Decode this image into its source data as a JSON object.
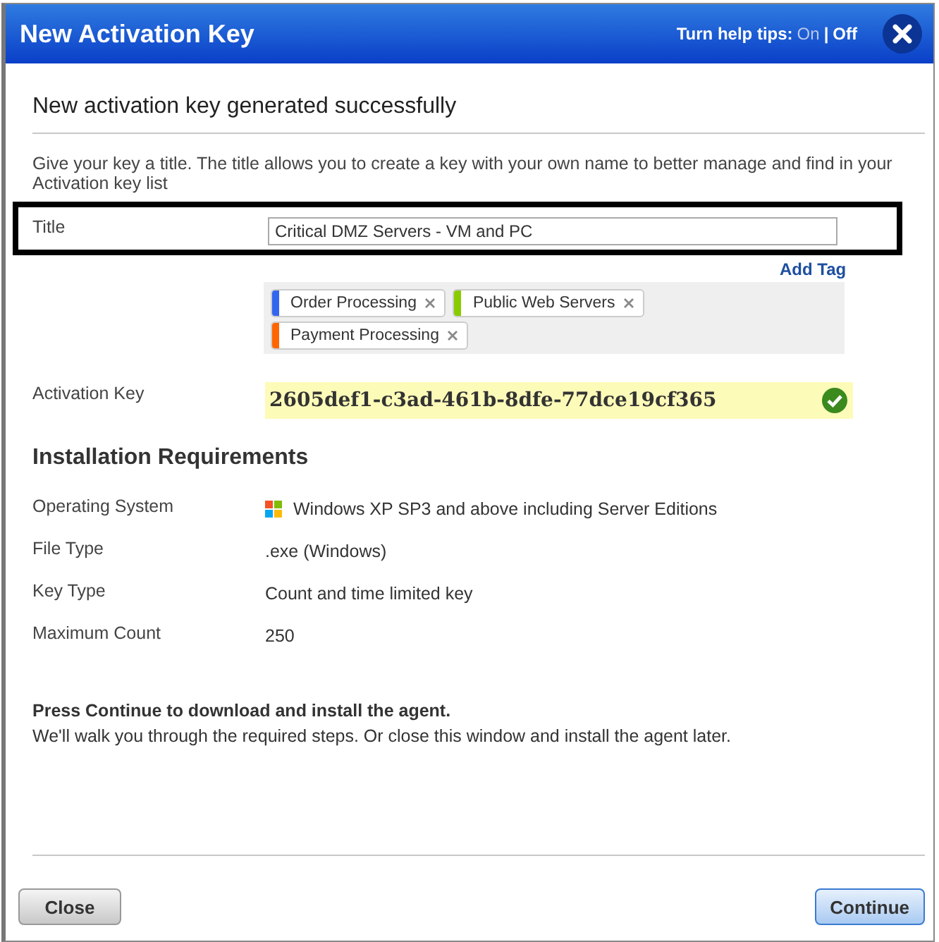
{
  "window": {
    "title": "New Activation Key"
  },
  "help_tips": {
    "label": "Turn help tips:",
    "options": [
      {
        "label": "On",
        "selected": false
      },
      {
        "label": "Off",
        "selected": true
      }
    ],
    "separator": "|"
  },
  "heading": "New activation key generated successfully",
  "description": "Give your key a title. The title allows you to create a key with your own name to better manage and find in your Activation key list",
  "title_field": {
    "label": "Title",
    "value": "Critical DMZ Servers - VM and PC"
  },
  "add_tag": "Add Tag",
  "tags": [
    {
      "label": "Order Processing",
      "color": "#3366ee"
    },
    {
      "label": "Public Web Servers",
      "color": "#88cc00"
    },
    {
      "label": "Payment Processing",
      "color": "#ff6600"
    }
  ],
  "activation_key": {
    "label": "Activation Key",
    "value": "2605def1-c3ad-461b-8dfe-77dce19cf365",
    "valid": true
  },
  "requirements": {
    "title": "Installation Requirements",
    "rows": [
      {
        "label": "Operating System",
        "value": "Windows XP SP3 and above including Server Editions",
        "kind": "os"
      },
      {
        "label": "File Type",
        "value": ".exe (Windows)",
        "kind": "text"
      },
      {
        "label": "Key Type",
        "value": "Count and time limited key",
        "kind": "text"
      },
      {
        "label": "Maximum Count",
        "value": "250",
        "kind": "text"
      }
    ]
  },
  "notice": {
    "headline": "Press Continue to download and install the agent.",
    "body": "We'll walk you through the required steps. Or close this window and install the agent later."
  },
  "buttons": [
    {
      "label": "Close",
      "kind": "secondary"
    },
    {
      "label": "Continue",
      "kind": "primary"
    }
  ]
}
